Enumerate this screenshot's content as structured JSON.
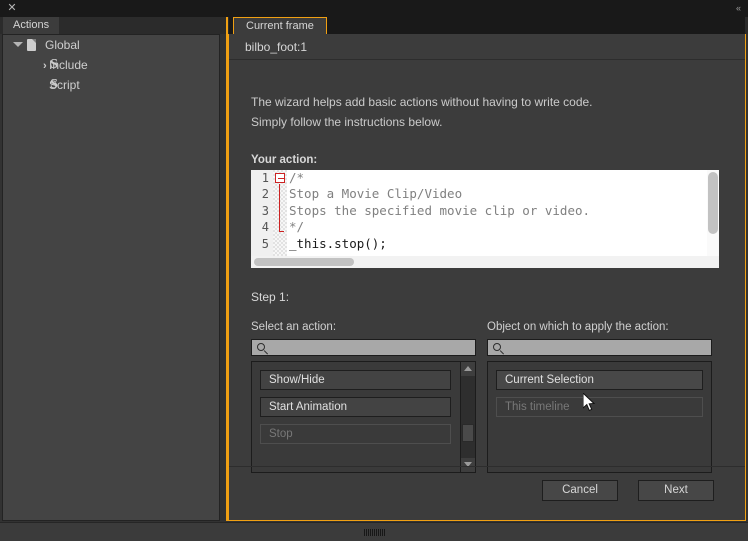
{
  "window": {
    "close_icon": "close-icon",
    "collapse_icon": "collapse-arrows-icon",
    "menu_icon": "hamburger-menu-icon",
    "panel_tab": "Actions"
  },
  "accent_color": "#f0a013",
  "tree": {
    "items": [
      {
        "label": "Global",
        "icon": "document-icon",
        "level": 0,
        "expanded": true
      },
      {
        "label": "Include",
        "icon": "include-script-icon",
        "level": 1
      },
      {
        "label": "Script",
        "icon": "script-icon",
        "level": 1
      }
    ]
  },
  "main": {
    "tab_label": "Current frame",
    "frame_label": "bilbo_foot:1",
    "intro_line1": "The wizard helps add basic actions without having to write code.",
    "intro_line2": "Simply follow the instructions below.",
    "your_action_label": "Your action:",
    "step_label": "Step 1:",
    "editor": {
      "line_numbers": [
        "1",
        "2",
        "3",
        "4",
        "5"
      ],
      "lines": [
        {
          "text": "/*",
          "kind": "comment"
        },
        {
          "text": "Stop a Movie Clip/Video",
          "kind": "comment"
        },
        {
          "text": "Stops the specified movie clip or video.",
          "kind": "comment"
        },
        {
          "text": "*/",
          "kind": "comment"
        },
        {
          "text": "_this.stop();",
          "kind": "code"
        }
      ],
      "fold_marker": "collapse-fold-icon"
    },
    "action_column": {
      "label": "Select an action:",
      "search_value": "",
      "search_placeholder": "",
      "search_icon": "search-icon",
      "items": [
        {
          "label": "Show/Hide",
          "disabled": false
        },
        {
          "label": "Start Animation",
          "disabled": false
        },
        {
          "label": "Stop",
          "disabled": true
        }
      ],
      "scrollbar": {
        "up_icon": "scroll-up-arrow-icon",
        "down_icon": "scroll-down-arrow-icon"
      }
    },
    "object_column": {
      "label": "Object on which to apply the action:",
      "search_value": "",
      "search_placeholder": "",
      "search_icon": "search-icon",
      "items": [
        {
          "label": "Current Selection",
          "disabled": false,
          "selected": true
        },
        {
          "label": "This timeline",
          "disabled": true
        }
      ]
    },
    "buttons": {
      "cancel": "Cancel",
      "next": "Next"
    }
  },
  "statusbar": {
    "grip_icon": "resize-grip-icon"
  }
}
